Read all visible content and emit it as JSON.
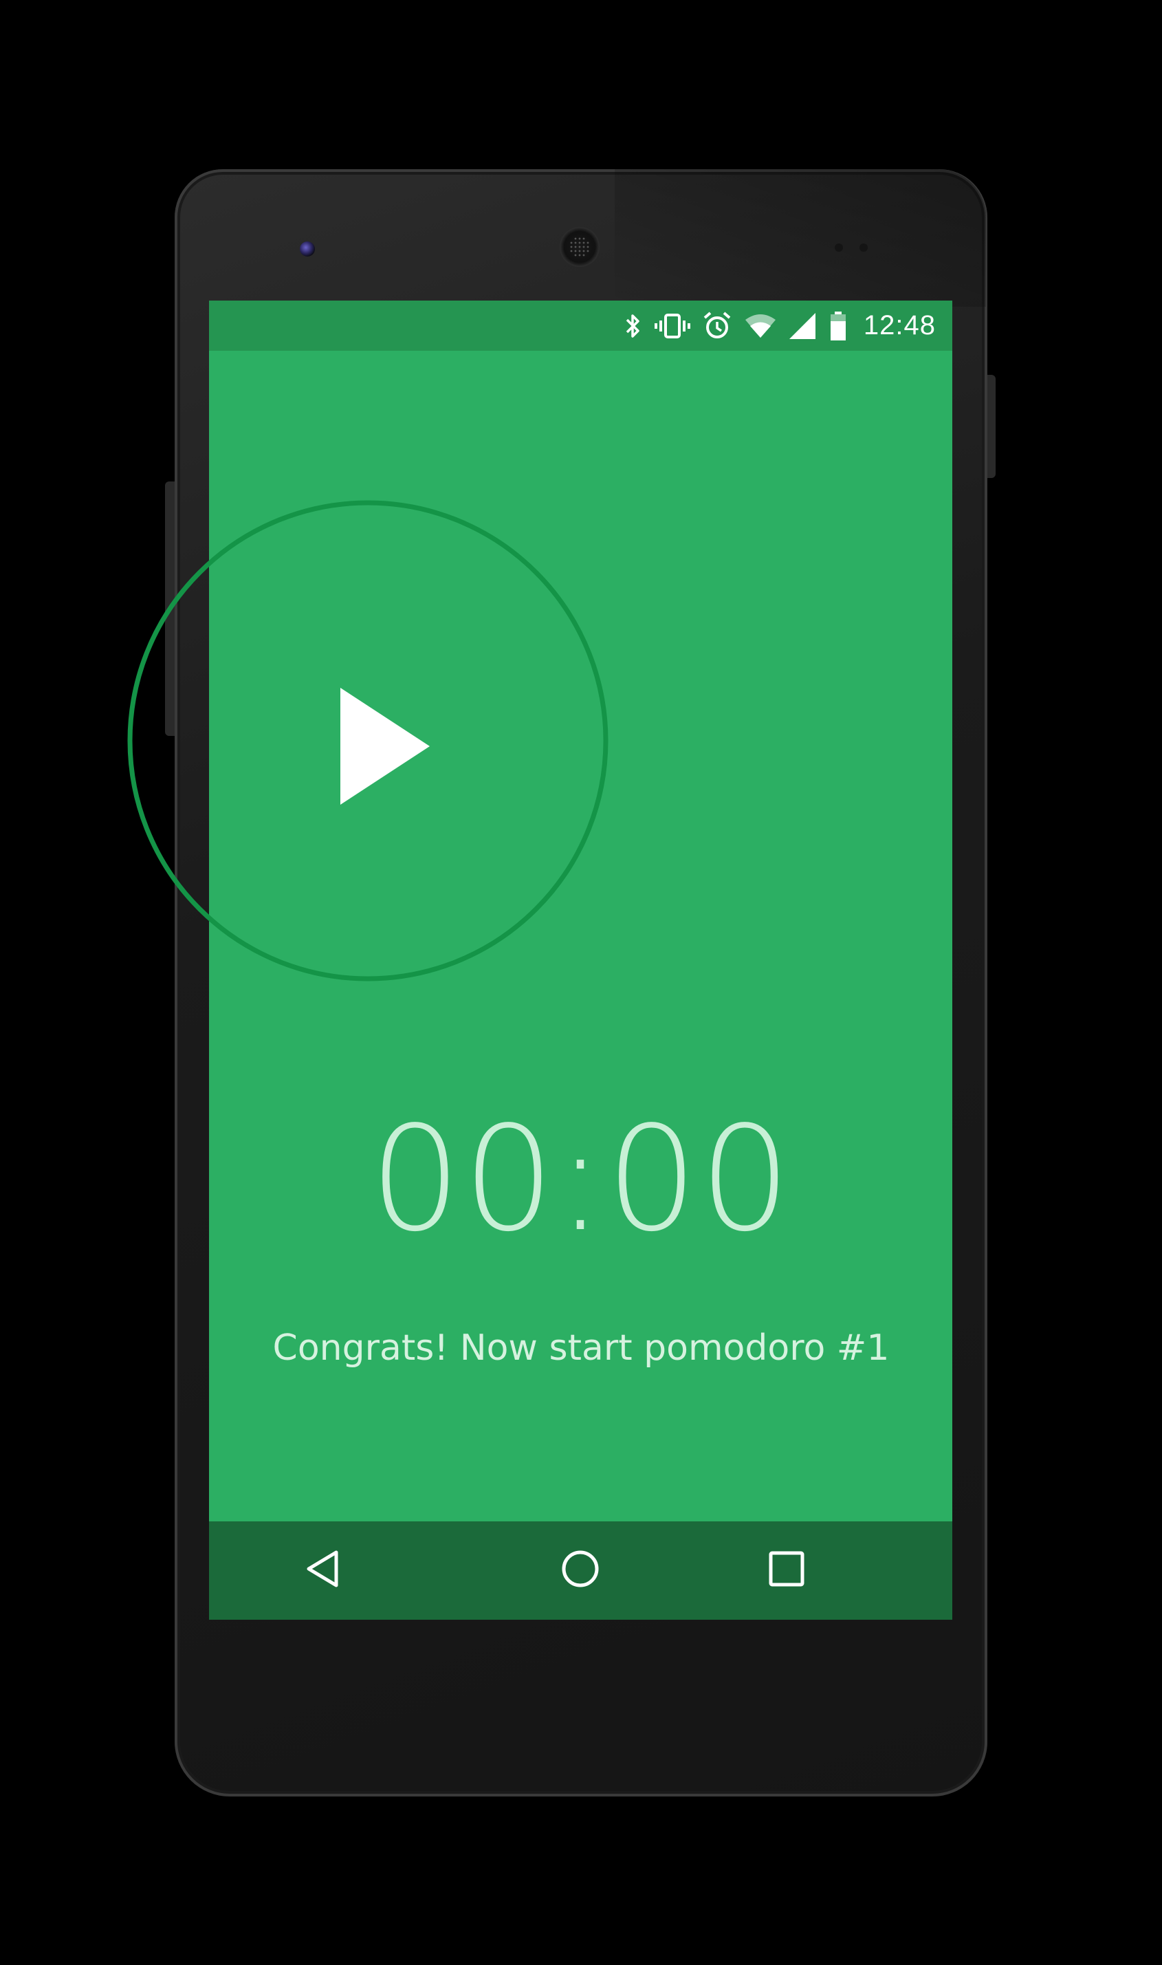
{
  "colors": {
    "background": "#000000",
    "app_primary": "#2caf63",
    "status_bar": "#259551",
    "nav_bar": "#1b6a3a",
    "ring": "#149447",
    "timer_text": "#c8f0d6",
    "play_icon": "#ffffff"
  },
  "status_bar": {
    "time": "12:48",
    "icons": [
      "bluetooth-icon",
      "vibrate-icon",
      "alarm-icon",
      "wifi-icon",
      "cell-signal-icon",
      "battery-icon"
    ]
  },
  "timer": {
    "display": "00:00",
    "play_icon": "play-icon"
  },
  "message": "Congrats! Now start pomodoro #1",
  "nav_bar": {
    "icons": [
      "back-icon",
      "home-icon",
      "recents-icon"
    ]
  }
}
